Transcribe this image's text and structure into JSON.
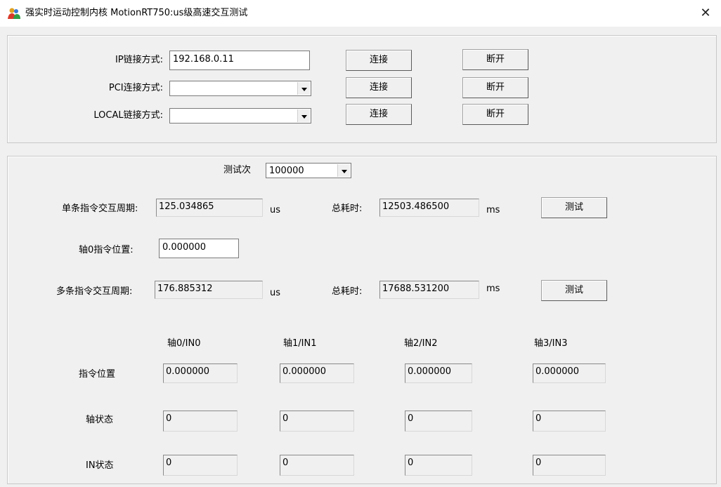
{
  "window": {
    "title": "强实时运动控制内核 MotionRT750:us级高速交互测试",
    "close_symbol": "✕",
    "icon": "app-people-icon"
  },
  "connection": {
    "ip_label": "IP链接方式:",
    "ip_value": "192.168.0.11",
    "pci_label": "PCI连接方式:",
    "pci_value": "",
    "local_label": "LOCAL链接方式:",
    "local_value": "",
    "connect_label": "连接",
    "disconnect_label": "断开"
  },
  "test": {
    "count_label": "测试次",
    "count_value": "100000",
    "single_label": "单条指令交互周期:",
    "single_value": "125.034865",
    "single_unit": "us",
    "total_label": "总耗时:",
    "single_total_value": "12503.486500",
    "total_unit": "ms",
    "test_button": "测试",
    "axis0_pos_label": "轴0指令位置:",
    "axis0_pos_value": "0.000000",
    "multi_label": "多条指令交互周期:",
    "multi_value": "176.885312",
    "multi_unit": "us",
    "multi_total_value": "17688.531200",
    "multi_total_unit": "ms"
  },
  "axes": {
    "headers": [
      "轴0/IN0",
      "轴1/IN1",
      "轴2/IN2",
      "轴3/IN3"
    ],
    "row_labels": [
      "指令位置",
      "轴状态",
      "IN状态"
    ],
    "cmd_pos": [
      "0.000000",
      "0.000000",
      "0.000000",
      "0.000000"
    ],
    "axis_status": [
      "0",
      "0",
      "0",
      "0"
    ],
    "in_status": [
      "0",
      "0",
      "0",
      "0"
    ]
  }
}
